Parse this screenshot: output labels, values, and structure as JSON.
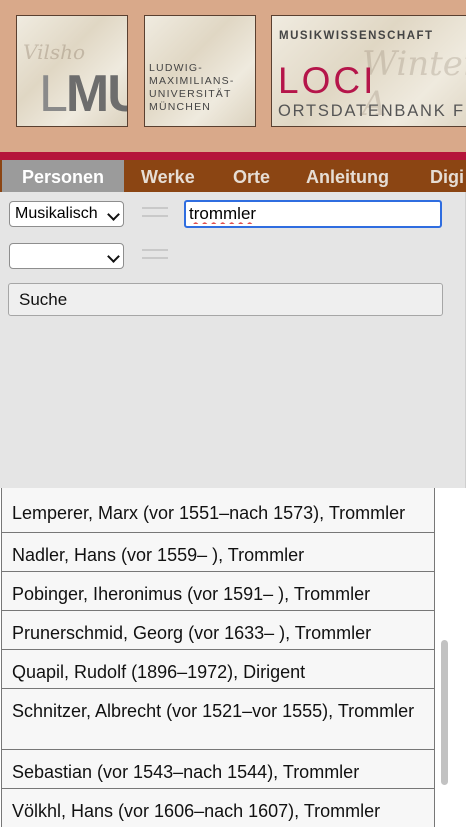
{
  "header": {
    "lmu_logo": "LMU",
    "university_lines": [
      "LUDWIG-",
      "MAXIMILIANS-",
      "UNIVERSITÄT",
      "MÜNCHEN"
    ],
    "department": "MUSIKWISSENSCHAFT",
    "project_title": "LOCI",
    "project_subtitle": "ORTSDATENBANK FÜ"
  },
  "nav": {
    "tabs": [
      {
        "label": "Personen",
        "active": true
      },
      {
        "label": "Werke",
        "active": false
      },
      {
        "label": "Orte",
        "active": false
      },
      {
        "label": "Anleitung",
        "active": false
      },
      {
        "label": "Digi",
        "active": false
      }
    ]
  },
  "search": {
    "field1_selected": "Musikalisch",
    "field2_selected": "",
    "query": "trommler",
    "submit_label": "Suche"
  },
  "results": [
    "Lemperer, Marx (vor 1551–nach 1573), Trommler",
    "Nadler, Hans (vor 1559–     ), Trommler",
    "Pobinger, Iheronimus (vor 1591–     ), Trommler",
    "Prunerschmid, Georg (vor 1633–     ), Trommler",
    "Quapil, Rudolf (1896–1972), Dirigent",
    "Schnitzer, Albrecht (vor 1521–vor 1555), Trommler",
    "Sebastian (vor 1543–nach 1544), Trommler",
    "Völkhl, Hans (vor 1606–nach 1607), Trommler"
  ],
  "colors": {
    "banner": "#d9a98a",
    "accent_red": "#b5153a",
    "nav_bg": "#8b4513",
    "nav_active": "#9b9b9b",
    "focus_blue": "#2f6de0"
  }
}
